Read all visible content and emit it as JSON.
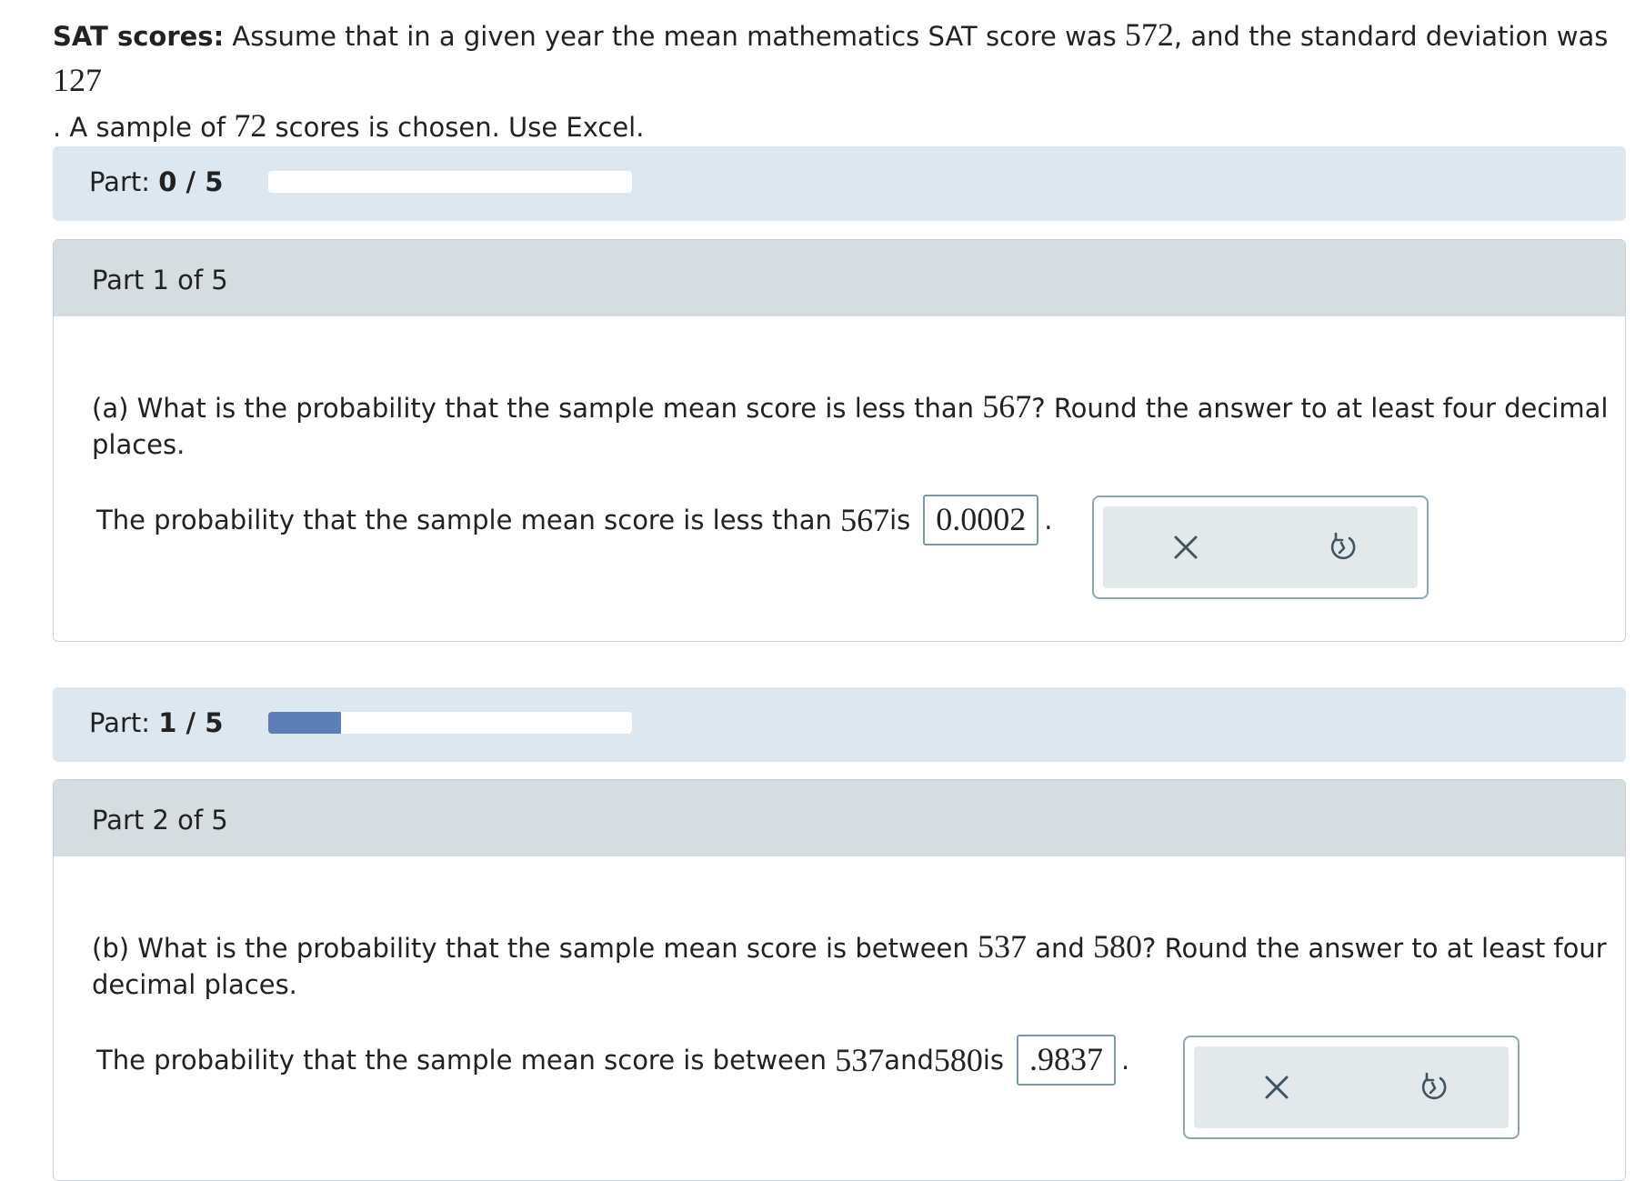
{
  "intro": {
    "heading": "SAT scores:",
    "t1": " Assume that in a given year the mean mathematics SAT score was ",
    "mean": "572",
    "t2": ", and the standard deviation was ",
    "sd": "127",
    "t3": ". A sample of ",
    "n": "72",
    "t4": " scores is chosen. Use Excel."
  },
  "progress": [
    {
      "label": "Part:",
      "value": "0 / 5",
      "fraction": 0.0
    },
    {
      "label": "Part:",
      "value": "1 / 5",
      "fraction": 0.2
    }
  ],
  "parts": [
    {
      "header": "Part 1 of 5",
      "question": {
        "t1": "(a) What is the probability that the sample mean score is less than ",
        "v1": "567",
        "t2": "? Round the answer to at least four decimal places."
      },
      "answer": {
        "t1": "The probability that the sample mean score is less than ",
        "v1": "567",
        "t2": " is",
        "value": "0.0002",
        "end": "."
      }
    },
    {
      "header": "Part 2 of 5",
      "question": {
        "t1": "(b) What is the probability that the sample mean score is between ",
        "v1": "537",
        "t2": " and ",
        "v2": "580",
        "t3": "? Round the answer to at least four decimal places."
      },
      "answer": {
        "t1": "The probability that the sample mean score is between ",
        "v1": "537",
        "t2": " and ",
        "v2": "580",
        "t3": " is",
        "value": ".9837",
        "end": "."
      }
    }
  ],
  "icons": {
    "clear": "close-icon",
    "undo": "undo-icon"
  },
  "colors": {
    "progress_fill": "#5b7fb4",
    "progress_panel": "#dde7f0",
    "part_header": "#d5dde1"
  }
}
